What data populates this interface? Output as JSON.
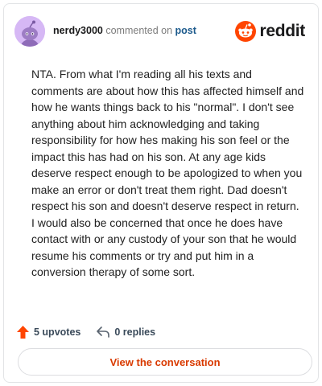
{
  "comment": {
    "username": "nerdy3000",
    "commented_on": "commented on",
    "post_link": "post",
    "body": "NTA. From what I'm reading all his texts and comments are about how this has affected himself and how he wants things back to his \"normal\". I don't see anything about him acknowledging and taking responsibility for how hes making his son feel or the impact this has had on his son. At any age kids deserve respect enough to be apologized to when you make an error or don't treat them right. Dad doesn't respect his son and doesn't deserve respect in return. I would also be concerned that once he does have contact with or any custody of your son that he would resume his comments or try and put him in a conversion therapy of some sort.",
    "upvotes": "5 upvotes",
    "replies": "0 replies"
  },
  "brand": {
    "name": "reddit",
    "icon": "reddit-snoo-icon",
    "color": "#ff4500"
  },
  "actions": {
    "upvote_icon": "upvote-arrow-icon",
    "reply_icon": "reply-arrow-icon",
    "upvote_color": "#ff4500"
  },
  "button": {
    "label": "View the conversation",
    "color": "#d93a00"
  },
  "avatar": {
    "icon": "snoo-avatar-icon",
    "background": "#d6b8f5"
  }
}
